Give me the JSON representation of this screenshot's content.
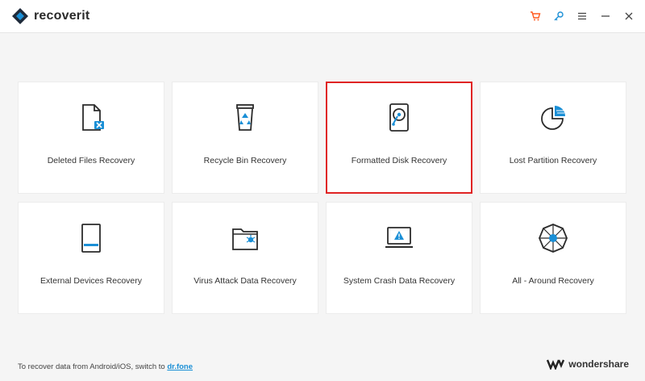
{
  "app": {
    "name": "recoverit"
  },
  "toolbar": {
    "icons": [
      "cart-icon",
      "key-icon",
      "menu-icon",
      "minimize-icon",
      "close-icon"
    ],
    "accent_cart": "#ff5a1f",
    "accent_key": "#1a8fd6"
  },
  "cards": [
    {
      "label": "Deleted Files Recovery",
      "icon": "deleted-file-icon"
    },
    {
      "label": "Recycle Bin Recovery",
      "icon": "recycle-bin-icon"
    },
    {
      "label": "Formatted Disk Recovery",
      "icon": "formatted-disk-icon",
      "selected": true
    },
    {
      "label": "Lost Partition Recovery",
      "icon": "lost-partition-icon"
    },
    {
      "label": "External Devices Recovery",
      "icon": "external-device-icon"
    },
    {
      "label": "Virus Attack Data Recovery",
      "icon": "virus-folder-icon"
    },
    {
      "label": "System Crash Data Recovery",
      "icon": "system-crash-icon"
    },
    {
      "label": "All - Around Recovery",
      "icon": "all-around-icon"
    }
  ],
  "footer": {
    "text": "To recover data from Android/iOS, switch to",
    "link": "dr.fone"
  },
  "brand": {
    "name": "wondershare"
  },
  "colors": {
    "accent": "#1a8fd6",
    "selection": "#e02424",
    "icon": "#2b2b2b"
  }
}
